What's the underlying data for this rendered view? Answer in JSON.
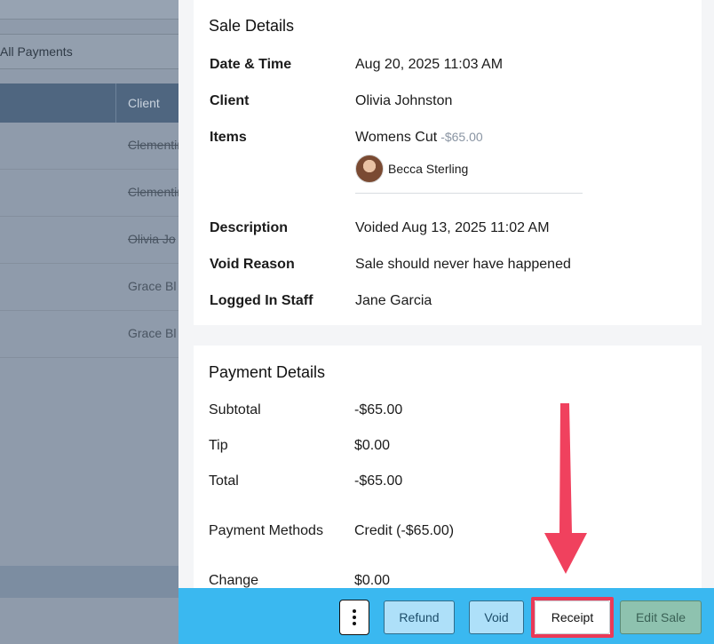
{
  "background": {
    "filter_label": "All Payments",
    "column_client": "Client",
    "rows": [
      {
        "client": "Clementine",
        "voided": true
      },
      {
        "client": "Clementine",
        "voided": true
      },
      {
        "client": "Olivia Jo",
        "voided": true
      },
      {
        "client": "Grace Bl",
        "voided": false
      },
      {
        "client": "Grace Bl",
        "voided": false
      }
    ]
  },
  "sale_details": {
    "title": "Sale Details",
    "date_label": "Date & Time",
    "date_value": "Aug 20, 2025 11:03 AM",
    "client_label": "Client",
    "client_value": "Olivia Johnston",
    "items_label": "Items",
    "item_name": "Womens Cut",
    "item_price": "-$65.00",
    "staff_name": "Becca Sterling",
    "description_label": "Description",
    "description_value": "Voided Aug 13, 2025 11:02 AM",
    "void_reason_label": "Void Reason",
    "void_reason_value": "Sale should never have happened",
    "logged_in_label": "Logged In Staff",
    "logged_in_value": "Jane Garcia"
  },
  "payment_details": {
    "title": "Payment Details",
    "subtotal_label": "Subtotal",
    "subtotal_value": "-$65.00",
    "tip_label": "Tip",
    "tip_value": "$0.00",
    "total_label": "Total",
    "total_value": "-$65.00",
    "methods_label": "Payment Methods",
    "methods_value": "Credit (-$65.00)",
    "change_label": "Change",
    "change_value": "$0.00"
  },
  "footer": {
    "refund_label": "Refund",
    "void_label": "Void",
    "receipt_label": "Receipt",
    "edit_label": "Edit Sale"
  },
  "colors": {
    "footer_bg": "#3ab8f0",
    "highlight": "#ea3a58",
    "arrow": "#f0415e"
  }
}
